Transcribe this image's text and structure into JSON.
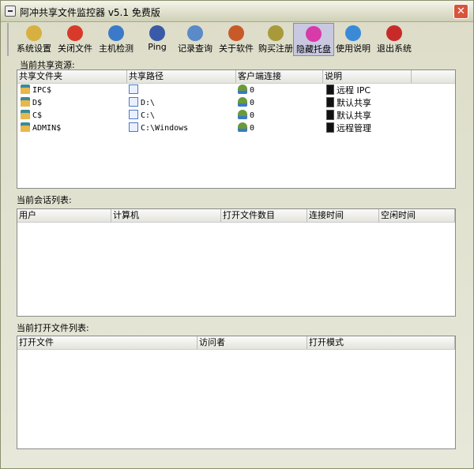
{
  "window": {
    "title": "阿冲共享文件监控器 v5.1 免费版",
    "close": "✕"
  },
  "toolbar": [
    {
      "label": "系统设置",
      "icon": "settings-icon",
      "color": "#d8b040"
    },
    {
      "label": "关闭文件",
      "icon": "close-file-icon",
      "color": "#d83a2a"
    },
    {
      "label": "主机检测",
      "icon": "globe-icon",
      "color": "#3a7ac8"
    },
    {
      "label": "Ping",
      "icon": "network-icon",
      "color": "#3a5aa8"
    },
    {
      "label": "记录查询",
      "icon": "search-log-icon",
      "color": "#5a8ac8"
    },
    {
      "label": "关于软件",
      "icon": "about-icon",
      "color": "#c85a2a"
    },
    {
      "label": "购买注册",
      "icon": "key-icon",
      "color": "#a89a3a"
    },
    {
      "label": "隐藏托盘",
      "icon": "tray-icon",
      "color": "#d83aa8"
    },
    {
      "label": "使用说明",
      "icon": "help-icon",
      "color": "#3a8ad8"
    },
    {
      "label": "退出系统",
      "icon": "exit-icon",
      "color": "#c82a2a"
    }
  ],
  "shares": {
    "label": "当前共享资源:",
    "columns": [
      "共享文件夹",
      "共享路径",
      "客户端连接",
      "说明"
    ],
    "rows": [
      {
        "name": "IPC$",
        "path": "",
        "clients": "0",
        "desc": "远程 IPC"
      },
      {
        "name": "D$",
        "path": "D:\\",
        "clients": "0",
        "desc": "默认共享"
      },
      {
        "name": "C$",
        "path": "C:\\",
        "clients": "0",
        "desc": "默认共享"
      },
      {
        "name": "ADMIN$",
        "path": "C:\\Windows",
        "clients": "0",
        "desc": "远程管理"
      }
    ]
  },
  "sessions": {
    "label": "当前会话列表:",
    "columns": [
      "用户",
      "计算机",
      "打开文件数目",
      "连接时间",
      "空闲时间"
    ]
  },
  "openfiles": {
    "label": "当前打开文件列表:",
    "columns": [
      "打开文件",
      "访问者",
      "打开模式"
    ]
  }
}
